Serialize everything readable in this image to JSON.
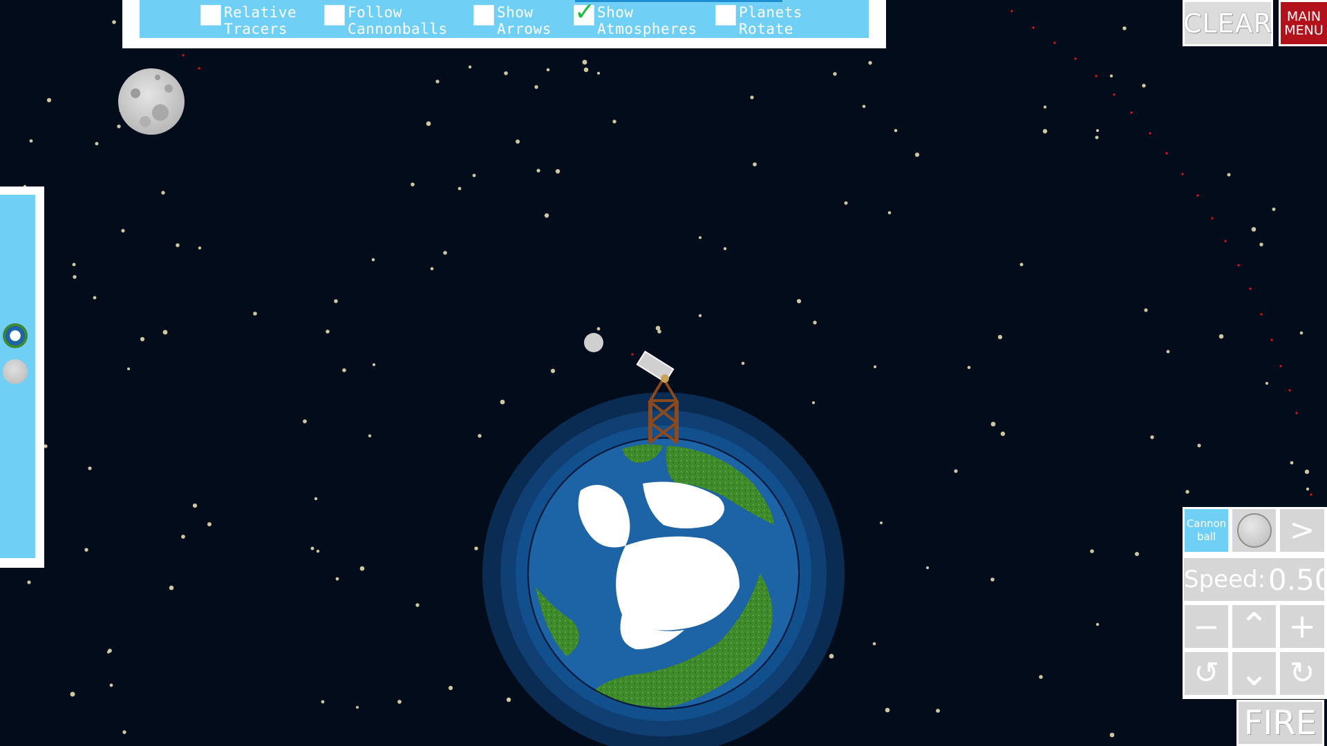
{
  "options": [
    {
      "label": "Relative\nTracers",
      "checked": false
    },
    {
      "label": "Follow\nCannonballs",
      "checked": false
    },
    {
      "label": "Show\nArrows",
      "checked": false
    },
    {
      "label": "Show\nAtmospheres",
      "checked": true
    },
    {
      "label": "Planets\nRotate",
      "checked": false
    }
  ],
  "buttons": {
    "clear": "CLEAR",
    "main_menu": "MAIN\nMENU",
    "projectile": "Cannon\nball",
    "next": ">",
    "decrease": "−",
    "increase": "+",
    "aim_up": "⌃",
    "aim_down": "⌄",
    "rotate_ccw": "↺",
    "rotate_cw": "↻",
    "fire": "FIRE"
  },
  "speed": {
    "label": "Speed:",
    "value": "0.50"
  },
  "colors": {
    "space": "#030c1b",
    "panel": "#6fcff5",
    "button": "#d6d6d6",
    "main_menu": "#b4121b",
    "ocean": "#1c64a5",
    "land": "#3e8a2a",
    "ice": "#ffffff",
    "atmosphere": "#0d3c6e",
    "tower": "#8a4a1e",
    "tracer": "#e01616",
    "check": "#15c235"
  },
  "icons": [
    "checkbox-icon",
    "earth-icon",
    "moon-icon",
    "cannon-icon",
    "cannonball-icon"
  ]
}
